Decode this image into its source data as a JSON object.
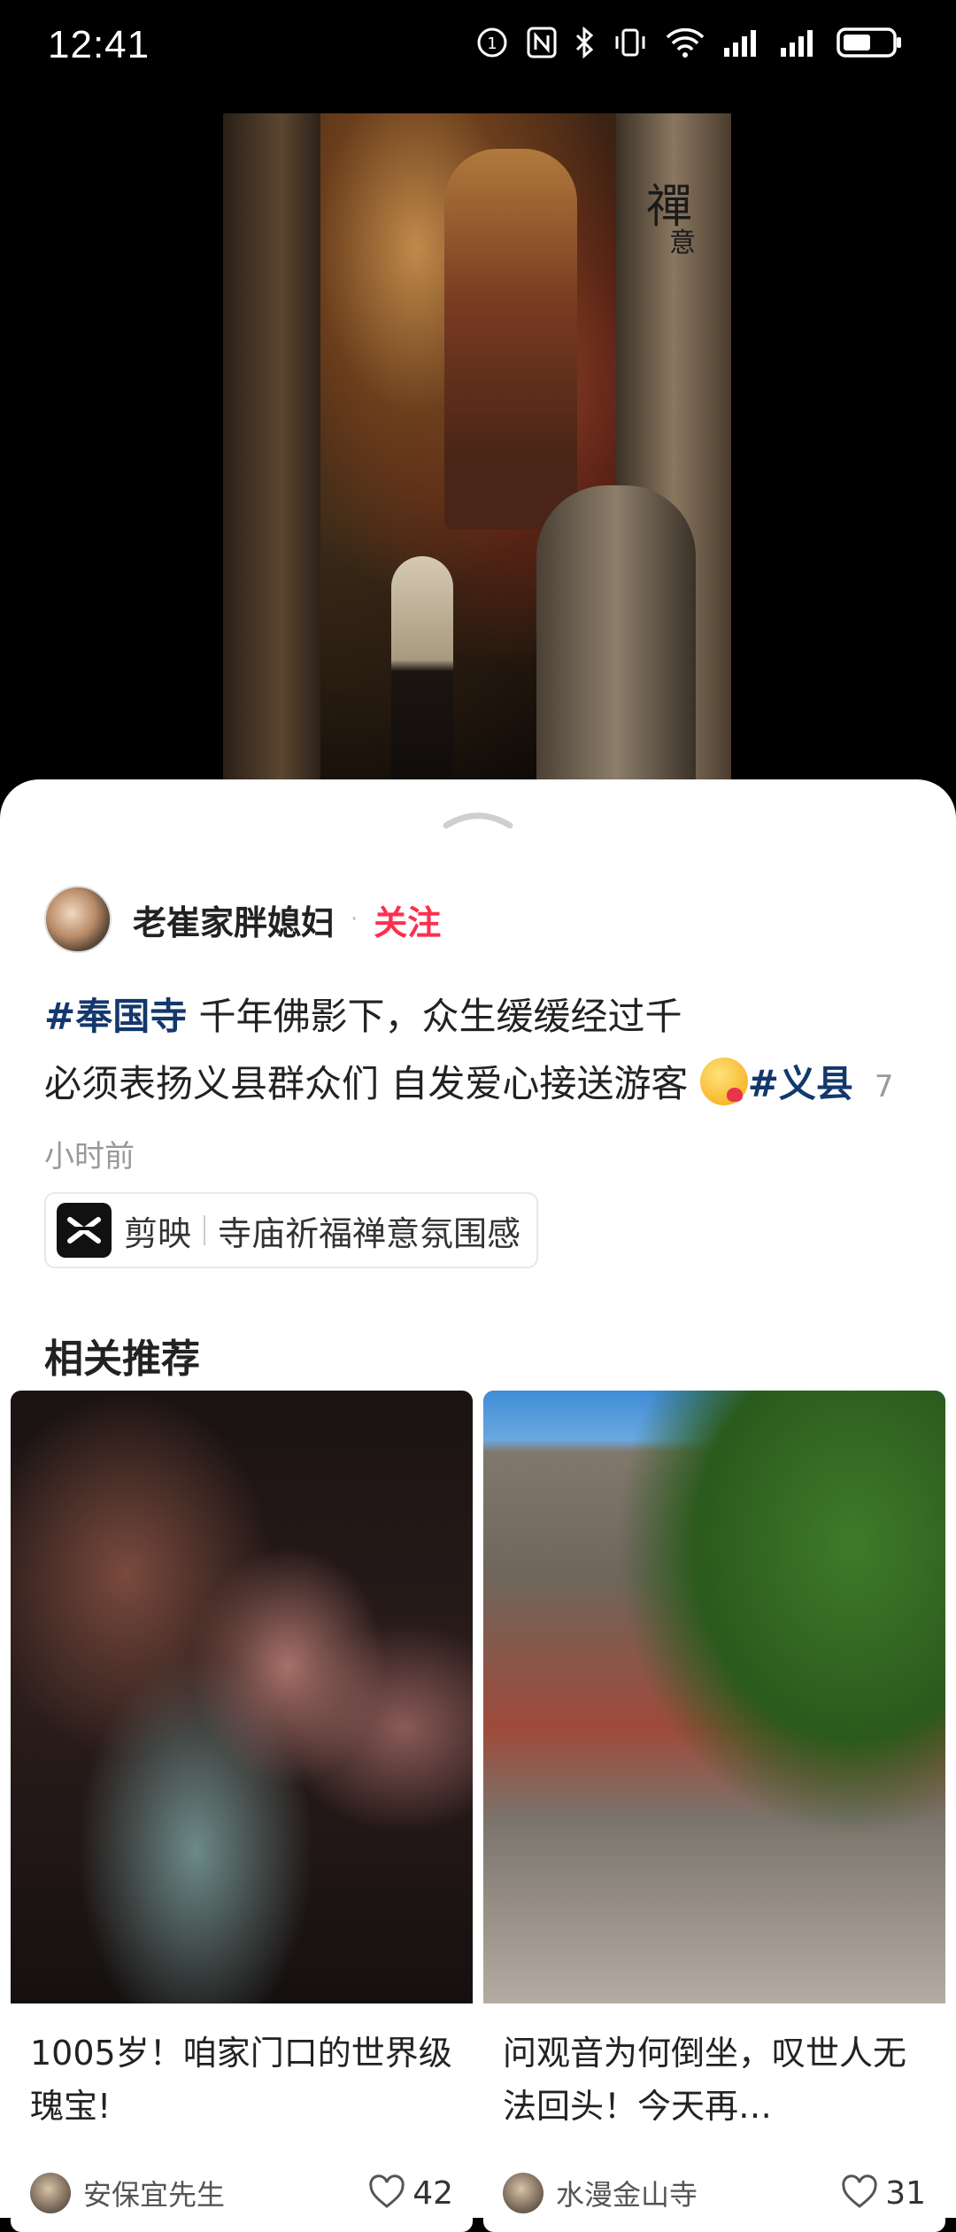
{
  "status_bar": {
    "time": "12:41",
    "icons": [
      "notification-badge-icon",
      "nfc-icon",
      "bluetooth-icon",
      "vibrate-icon",
      "wifi-icon",
      "signal-icon",
      "signal-icon",
      "battery-icon"
    ]
  },
  "hero": {
    "calligraphy": "禪",
    "calligraphy_small": "意"
  },
  "post": {
    "author": "老崔家胖媳妇",
    "separator": "·",
    "follow_label": "关注",
    "hashtag_1": "#奉国寺",
    "text_1": " 千年佛影下，众生缓缓经过千",
    "text_2": "必须表扬义县群众们 自发爱心接送游客 ",
    "hashtag_2": "#义县",
    "time_ago": "7小时前"
  },
  "capcut": {
    "app_name": "剪映",
    "template_name": "寺庙祈福禅意氛围感"
  },
  "related": {
    "title": "相关推荐",
    "cards": [
      {
        "title": "1005岁！咱家门口的世界级瑰宝!",
        "user": "安保宜先生",
        "likes": "42"
      },
      {
        "title": "问观音为何倒坐，叹世人无法回头！今天再…",
        "user": "水漫金山寺",
        "likes": "31"
      }
    ]
  },
  "colors": {
    "follow": "#ff2e4d",
    "hashtag": "#13386c",
    "background_top": "#000000",
    "sheet": "#ffffff"
  }
}
